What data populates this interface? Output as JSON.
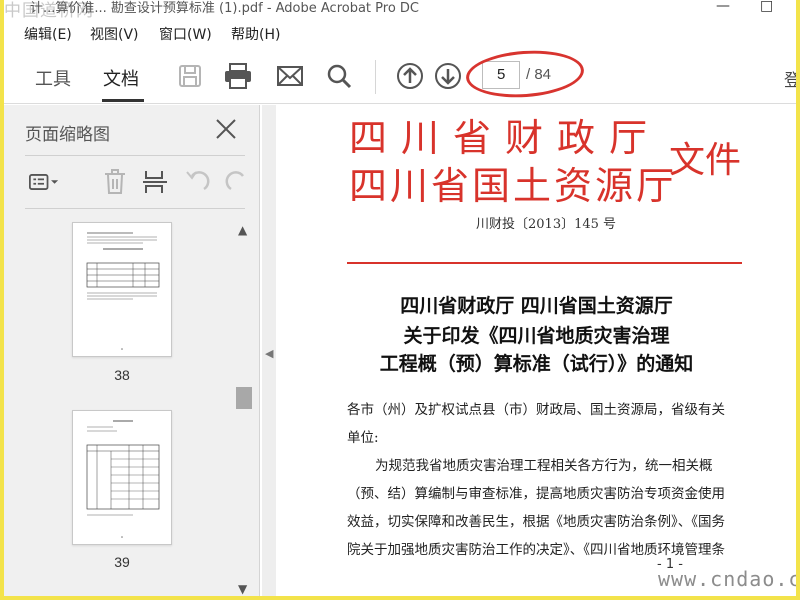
{
  "window": {
    "title": "计...算价准... 勘查设计预算标准 (1).pdf - Adobe Acrobat Pro DC",
    "watermark_logo": "中国道桥网",
    "minimize": "—",
    "maximize": "□"
  },
  "menu": {
    "items": [
      {
        "label": "编辑(E)"
      },
      {
        "label": "视图(V)"
      },
      {
        "label": "窗口(W)"
      },
      {
        "label": "帮助(H)"
      }
    ]
  },
  "toolbar": {
    "tabs": [
      {
        "label": "工具"
      },
      {
        "label": "文档"
      }
    ],
    "current_page": "5",
    "total_pages": "/ 84",
    "right_clipped": "登",
    "icons": [
      "save-icon",
      "print-icon",
      "mail-icon",
      "search-icon",
      "page-up-icon",
      "page-down-icon"
    ],
    "annotation_color": "#d8342f"
  },
  "sidebar": {
    "title": "页面缩略图",
    "thumbnails": [
      {
        "label": "38"
      },
      {
        "label": "39"
      }
    ],
    "tools": [
      "thumbnail-options-icon",
      "delete-icon",
      "extract-icon",
      "undo-icon",
      "redo-icon"
    ]
  },
  "document": {
    "header_line1": "四川省财政厅",
    "header_line2": "四川省国土资源厅",
    "header_suffix": "文件",
    "doc_number": "川财投〔2013〕145 号",
    "heading_line1": "四川省财政厅 四川省国土资源厅",
    "heading_line2": "关于印发《四川省地质灾害治理",
    "heading_line3": "工程概（预）算标准（试行）》的通知",
    "body_line1": "各市（州）及扩权试点县（市）财政局、国土资源局，省级有关",
    "body_line2": "单位:",
    "body_line3": "为规范我省地质灾害治理工程相关各方行为，统一相关概",
    "body_line4": "（预、结）算编制与审查标准，提高地质灾害防治专项资金使用",
    "body_line5": "效益，切实保障和改善民生，根据《地质灾害防治条例》、《国务",
    "body_line6": "院关于加强地质灾害防治工作的决定》、《四川省地质环境管理条",
    "page_number": "- 1 -",
    "accent_color": "#d8332b",
    "site_watermark": "www.cndao.com"
  }
}
